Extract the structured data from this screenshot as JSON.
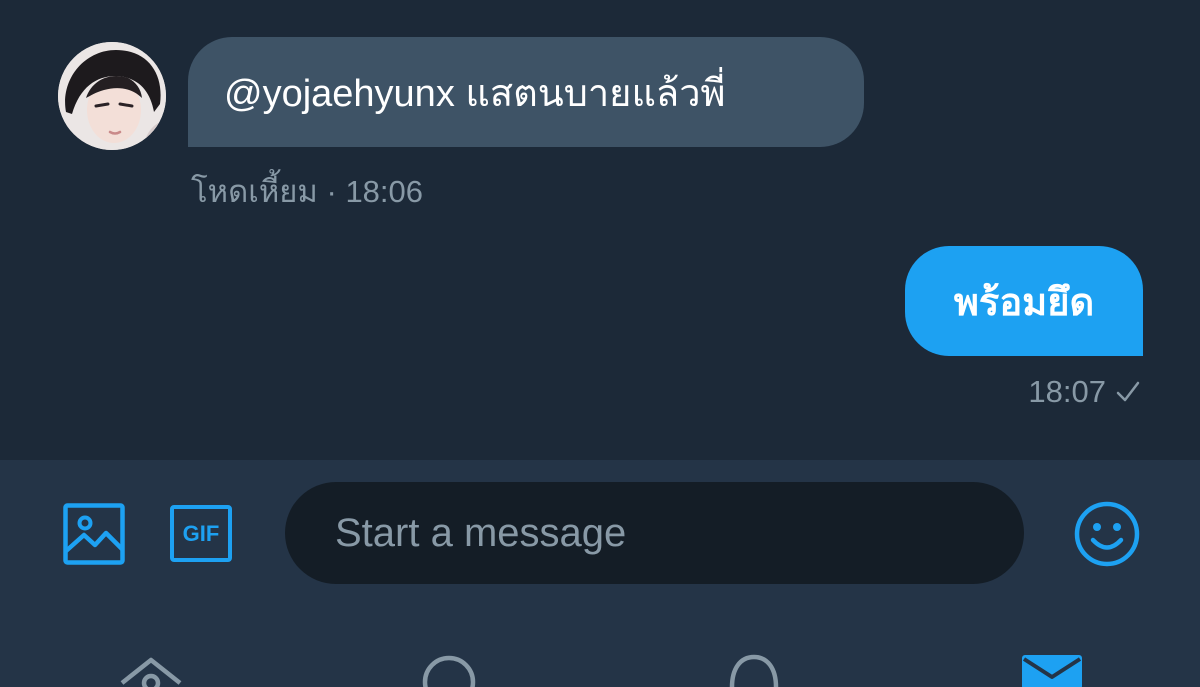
{
  "messages": [
    {
      "direction": "incoming",
      "text": "@yojaehyunx แสตนบายแล้วพี่",
      "sender": "โหดเหี้ยม",
      "time": "18:06"
    },
    {
      "direction": "outgoing",
      "text": "พร้อมยึด",
      "time": "18:07"
    }
  ],
  "meta_separator": "·",
  "composer": {
    "placeholder": "Start a message",
    "gif_label": "GIF"
  },
  "icons": {
    "image": "image-icon",
    "gif": "gif-icon",
    "emoji": "emoji-icon",
    "read_receipt": "checkmark-icon",
    "tabs": [
      "home-icon",
      "search-icon",
      "notifications-icon",
      "messages-icon"
    ]
  },
  "active_tab": "messages",
  "colors": {
    "accent": "#1da1f2",
    "bg": "#1c2938",
    "composer_bg": "#243447",
    "bubble_incoming": "#3e5366",
    "input_bg": "#141d26",
    "muted_text": "#8899a6",
    "tab_inactive": "#8899a6"
  }
}
